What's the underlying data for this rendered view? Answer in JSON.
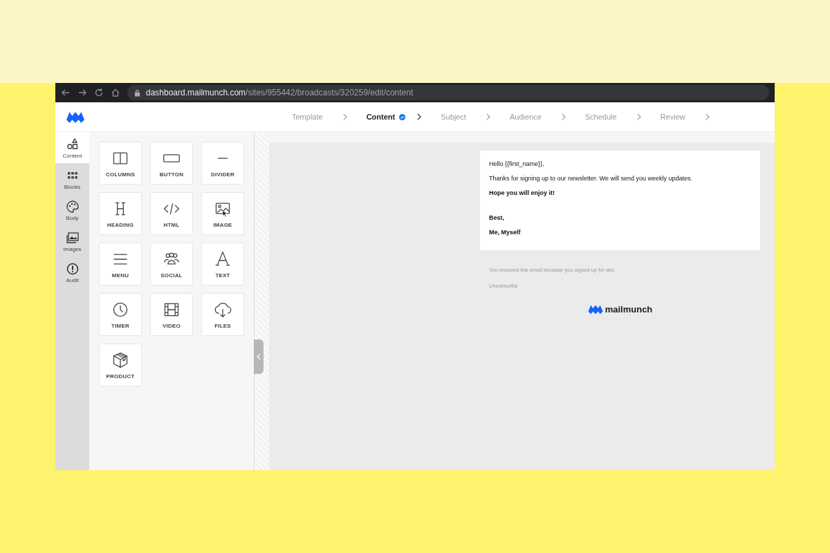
{
  "browser": {
    "url_host": "dashboard.mailmunch.com",
    "url_path": "/sites/955442/broadcasts/320259/edit/content"
  },
  "steps": [
    {
      "label": "Template",
      "selected": false,
      "done": false
    },
    {
      "label": "Content",
      "selected": true,
      "done": true
    },
    {
      "label": "Subject",
      "selected": false,
      "done": false
    },
    {
      "label": "Audience",
      "selected": false,
      "done": false
    },
    {
      "label": "Schedule",
      "selected": false,
      "done": false
    },
    {
      "label": "Review",
      "selected": false,
      "done": false
    }
  ],
  "sidebar": {
    "items": [
      {
        "label": "Content",
        "selected": true
      },
      {
        "label": "Blocks",
        "selected": false
      },
      {
        "label": "Body",
        "selected": false
      },
      {
        "label": "Images",
        "selected": false
      },
      {
        "label": "Audit",
        "selected": false
      }
    ]
  },
  "blocks": [
    {
      "label": "COLUMNS"
    },
    {
      "label": "BUTTON"
    },
    {
      "label": "DIVIDER"
    },
    {
      "label": "HEADING"
    },
    {
      "label": "HTML"
    },
    {
      "label": "IMAGE"
    },
    {
      "label": "MENU"
    },
    {
      "label": "SOCIAL"
    },
    {
      "label": "TEXT"
    },
    {
      "label": "TIMER"
    },
    {
      "label": "VIDEO"
    },
    {
      "label": "FILES"
    },
    {
      "label": "PRODUCT"
    }
  ],
  "email": {
    "body": [
      {
        "text": "Hello {{first_name}},",
        "bold": false
      },
      {
        "text": "Thanks for signing up to our newsletter. We will send you weekly updates.",
        "bold": false
      },
      {
        "text": "Hope you will enjoy it!",
        "bold": true
      }
    ],
    "signature": [
      {
        "text": "Best,",
        "bold": true
      },
      {
        "text": "Me, Myself",
        "bold": true
      }
    ],
    "footer_note": "You received this email because you signed up for abc.",
    "unsubscribe": "Unsubscribe",
    "brand": "mailmunch"
  }
}
